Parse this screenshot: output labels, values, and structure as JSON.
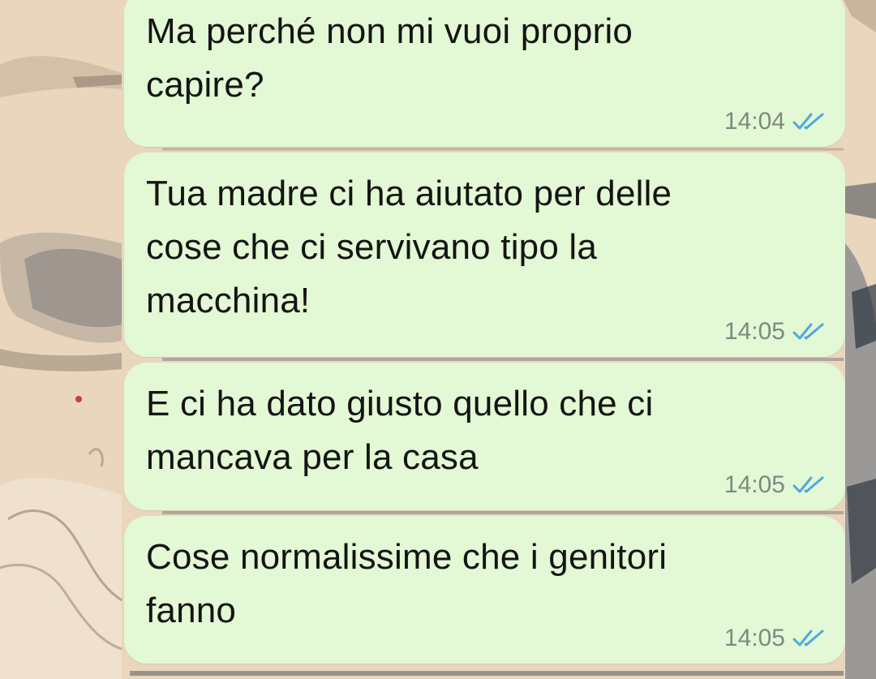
{
  "messages": [
    {
      "text": "Ma perché non mi vuoi proprio\ncapire?",
      "time": "14:04",
      "status": "read"
    },
    {
      "text": "Tua madre ci ha aiutato per delle\ncose che ci servivano tipo la\nmacchina!",
      "time": "14:05",
      "status": "read"
    },
    {
      "text": "E ci ha dato giusto quello che ci\nmancava per la casa",
      "time": "14:05",
      "status": "read"
    },
    {
      "text": "Cose normalissime che i genitori\nfanno",
      "time": "14:05",
      "status": "read"
    }
  ],
  "colors": {
    "bubble": "#e3f8d4",
    "read_ticks": "#4fa8e0",
    "time": "#7d8a80",
    "wallpaper": "#e8d3b8"
  },
  "icons": {
    "ticks": "double-check-icon"
  }
}
